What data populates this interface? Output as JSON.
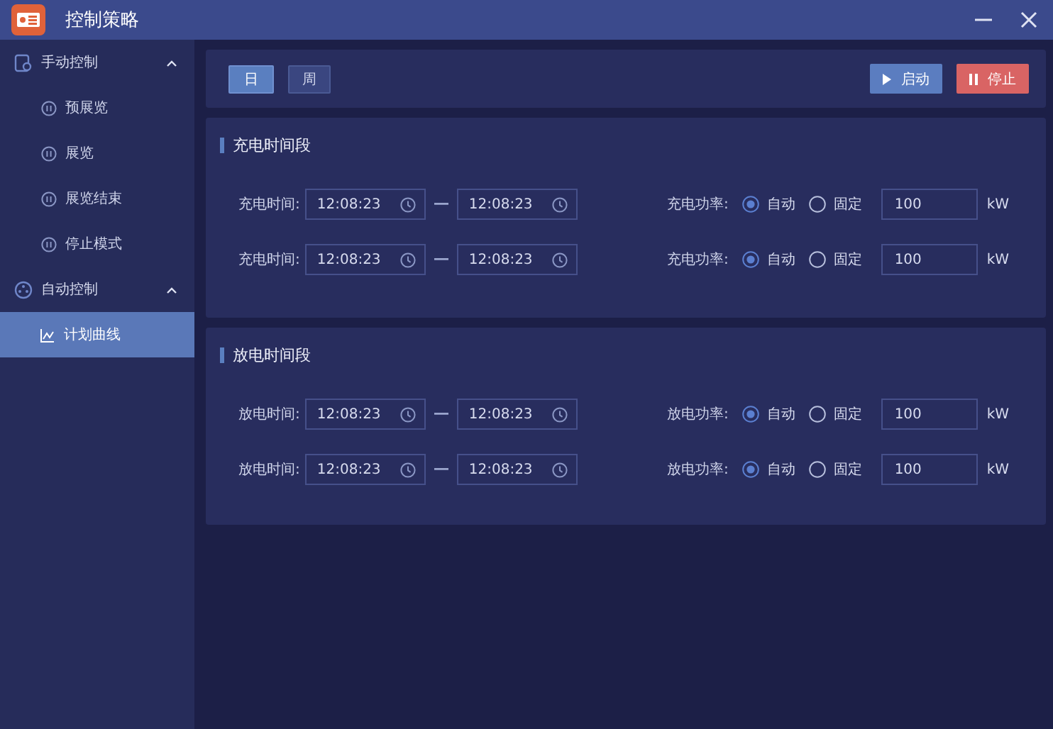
{
  "window": {
    "title": "控制策略"
  },
  "sidebar": {
    "groups": [
      {
        "label": "手动控制",
        "expanded": true,
        "items": [
          {
            "label": "预展览",
            "selected": false
          },
          {
            "label": "展览",
            "selected": false
          },
          {
            "label": "展览结束",
            "selected": false
          },
          {
            "label": "停止模式",
            "selected": false
          }
        ]
      },
      {
        "label": "自动控制",
        "expanded": true,
        "items": [
          {
            "label": "计划曲线",
            "selected": true
          }
        ]
      }
    ]
  },
  "tabs": [
    {
      "label": "日",
      "selected": true
    },
    {
      "label": "周",
      "selected": false
    }
  ],
  "actions": [
    {
      "label": "启动",
      "kind": "start"
    },
    {
      "label": "停止",
      "kind": "stop"
    }
  ],
  "sections": [
    {
      "title": "充电时间段",
      "rows": [
        {
          "time_label": "充电时间:",
          "start": "12:08:23",
          "end": "12:08:23",
          "power_label": "充电功率:",
          "options": [
            {
              "label": "自动",
              "selected": true
            },
            {
              "label": "固定",
              "selected": false
            }
          ],
          "value": "100",
          "unit": "kW"
        },
        {
          "time_label": "充电时间:",
          "start": "12:08:23",
          "end": "12:08:23",
          "power_label": "充电功率:",
          "options": [
            {
              "label": "自动",
              "selected": true
            },
            {
              "label": "固定",
              "selected": false
            }
          ],
          "value": "100",
          "unit": "kW"
        }
      ]
    },
    {
      "title": "放电时间段",
      "rows": [
        {
          "time_label": "放电时间:",
          "start": "12:08:23",
          "end": "12:08:23",
          "power_label": "放电功率:",
          "options": [
            {
              "label": "自动",
              "selected": true
            },
            {
              "label": "固定",
              "selected": false
            }
          ],
          "value": "100",
          "unit": "kW"
        },
        {
          "time_label": "放电时间:",
          "start": "12:08:23",
          "end": "12:08:23",
          "power_label": "放电功率:",
          "options": [
            {
              "label": "自动",
              "selected": true
            },
            {
              "label": "固定",
              "selected": false
            }
          ],
          "value": "100",
          "unit": "kW"
        }
      ]
    }
  ]
}
